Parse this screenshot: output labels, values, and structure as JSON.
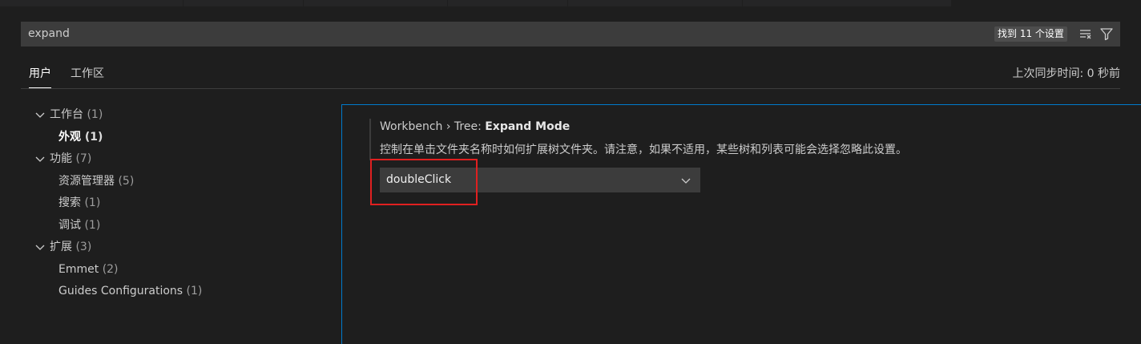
{
  "search": {
    "value": "expand",
    "result_count": "找到 11 个设置",
    "clear_icon": "clear-filter-icon",
    "filter_icon": "filter-icon"
  },
  "scopes": {
    "user_tab": "用户",
    "workspace_tab": "工作区",
    "sync_status": "上次同步时间: 0 秒前"
  },
  "toc": [
    {
      "label": "工作台",
      "count": "(1)",
      "expanded": true
    },
    {
      "label": "外观",
      "count": "(1)",
      "selected": true
    },
    {
      "label": "功能",
      "count": "(7)",
      "expanded": true
    },
    {
      "label": "资源管理器",
      "count": "(5)"
    },
    {
      "label": "搜索",
      "count": "(1)"
    },
    {
      "label": "调试",
      "count": "(1)"
    },
    {
      "label": "扩展",
      "count": "(3)",
      "expanded": true
    },
    {
      "label": "Emmet",
      "count": "(2)"
    },
    {
      "label": "Guides Configurations",
      "count": "(1)"
    }
  ],
  "setting": {
    "category": "Workbench › Tree: ",
    "name": "Expand Mode",
    "description": "控制在单击文件夹名称时如何扩展树文件夹。请注意，如果不适用，某些树和列表可能会选择忽略此设置。",
    "value": "doubleClick"
  },
  "colors": {
    "background": "#1e1e1e",
    "focus_border": "#007acc",
    "highlight": "#e02020"
  }
}
